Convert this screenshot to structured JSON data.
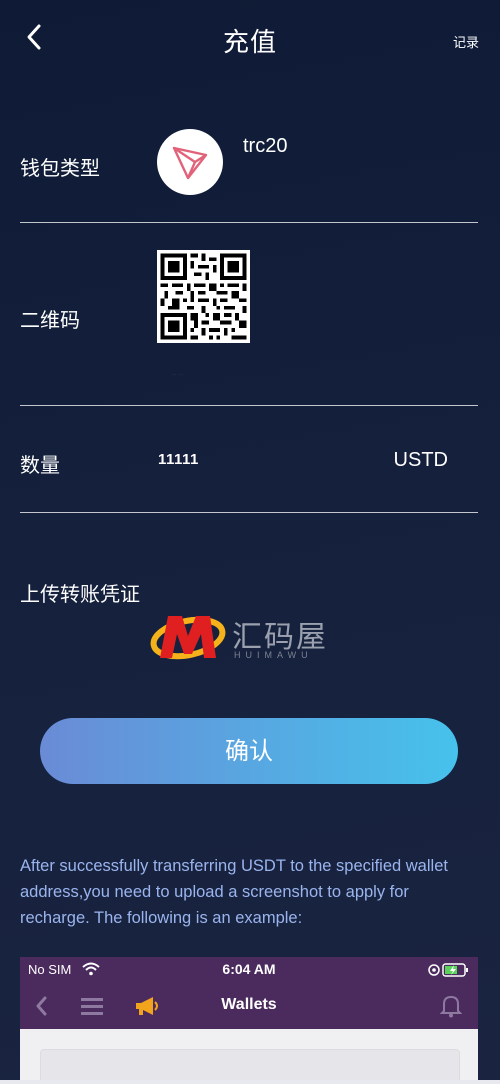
{
  "header": {
    "title": "充值",
    "records_label": "记录"
  },
  "wallet_type": {
    "label": "钱包类型",
    "value": "trc20",
    "logo_icon": "tron-logo-icon"
  },
  "qr": {
    "label": "二维码",
    "small_text": ".. .."
  },
  "amount": {
    "label": "数量",
    "value": "11111",
    "unit": "USTD"
  },
  "upload": {
    "label": "上传转账凭证",
    "watermark_text": "汇码屋",
    "watermark_sub": "HUIMAWU"
  },
  "confirm_label": "确认",
  "instruction": "After successfully transferring USDT to the specified wallet address,you need to upload a screenshot to apply for recharge. The following is an example:",
  "example": {
    "carrier": "No SIM",
    "time": "6:04 AM",
    "nav_title": "Wallets"
  },
  "colors": {
    "background": "#15213d",
    "button_start": "#6a8bd6",
    "button_end": "#46c2ec",
    "instruction_text": "#9ab4ee",
    "example_bar": "#4b2a5e",
    "tron_red": "#e0637a"
  }
}
